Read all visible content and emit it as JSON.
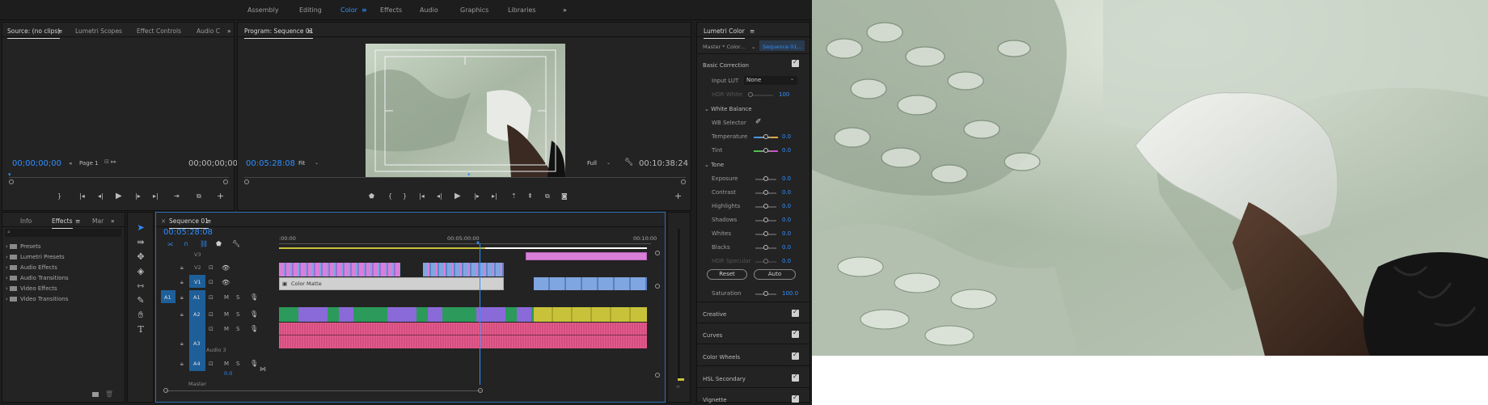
{
  "workspaces": [
    "Assembly",
    "Editing",
    "Color",
    "Effects",
    "Audio",
    "Graphics",
    "Libraries"
  ],
  "workspace_active": "Color",
  "workspace_more": "»",
  "source_panel": {
    "tabs": [
      "Source: (no clips)",
      "Lumetri Scopes",
      "Effect Controls",
      "Audio C"
    ],
    "more": "»",
    "timecode_left": "00;00;00;00",
    "timecode_right": "00;00;00;00",
    "page": "Page 1"
  },
  "program_panel": {
    "title": "Program: Sequence 01",
    "timecode_left": "00:05:28:08",
    "fit": "Fit",
    "quality": "Full",
    "timecode_right": "00:10:38:24"
  },
  "effects_panel": {
    "tabs": [
      "Info",
      "Effects",
      "Mar"
    ],
    "more": "»",
    "bins": [
      "Presets",
      "Lumetri Presets",
      "Audio Effects",
      "Audio Transitions",
      "Video Effects",
      "Video Transitions"
    ]
  },
  "sequence_panel": {
    "title": "Sequence 01",
    "timecode": "00:05:28:08",
    "ruler": [
      ":00:00",
      "00:05:00:00",
      "00:10:00"
    ],
    "tracks": [
      "V3",
      "V2",
      "V1",
      "A1",
      "A2",
      "A3",
      "A4"
    ],
    "source_patch_v": "V1",
    "source_patch_a": "A1",
    "audio3_label": "Audio 3",
    "master_label": "Master",
    "master_value": "0.0",
    "clip_label": "Color Matte",
    "mute": "M",
    "solo": "S"
  },
  "lumetri": {
    "title": "Lumetri Color",
    "master_tab": "Master * Color...",
    "sequence_tab": "Sequence 01...",
    "basic_correction": "Basic Correction",
    "input_lut_label": "Input LUT",
    "input_lut_value": "None",
    "hdr_white_label": "HDR White",
    "hdr_white_value": "100",
    "white_balance": "White Balance",
    "wb_selector": "WB Selector",
    "temperature_label": "Temperature",
    "temperature_value": "0.0",
    "tint_label": "Tint",
    "tint_value": "0.0",
    "tone": "Tone",
    "tone_rows": [
      {
        "label": "Exposure",
        "value": "0.0"
      },
      {
        "label": "Contrast",
        "value": "0.0"
      },
      {
        "label": "Highlights",
        "value": "0.0"
      },
      {
        "label": "Shadows",
        "value": "0.0"
      },
      {
        "label": "Whites",
        "value": "0.0"
      },
      {
        "label": "Blacks",
        "value": "0.0"
      },
      {
        "label": "HDR Specular",
        "value": "0.0"
      }
    ],
    "reset": "Reset",
    "auto": "Auto",
    "saturation_label": "Saturation",
    "saturation_value": "100.0",
    "sections": [
      "Creative",
      "Curves",
      "Color Wheels",
      "HSL Secondary",
      "Vignette"
    ]
  },
  "colors": {
    "accent": "#2f8fff",
    "clip_pink": "#d97fd9",
    "clip_blue": "#7fa6e0",
    "clip_green": "#2c9a5a",
    "clip_purple": "#8a6ad8",
    "clip_yellow": "#c8c23a",
    "audio_pink": "#e45f8f"
  }
}
